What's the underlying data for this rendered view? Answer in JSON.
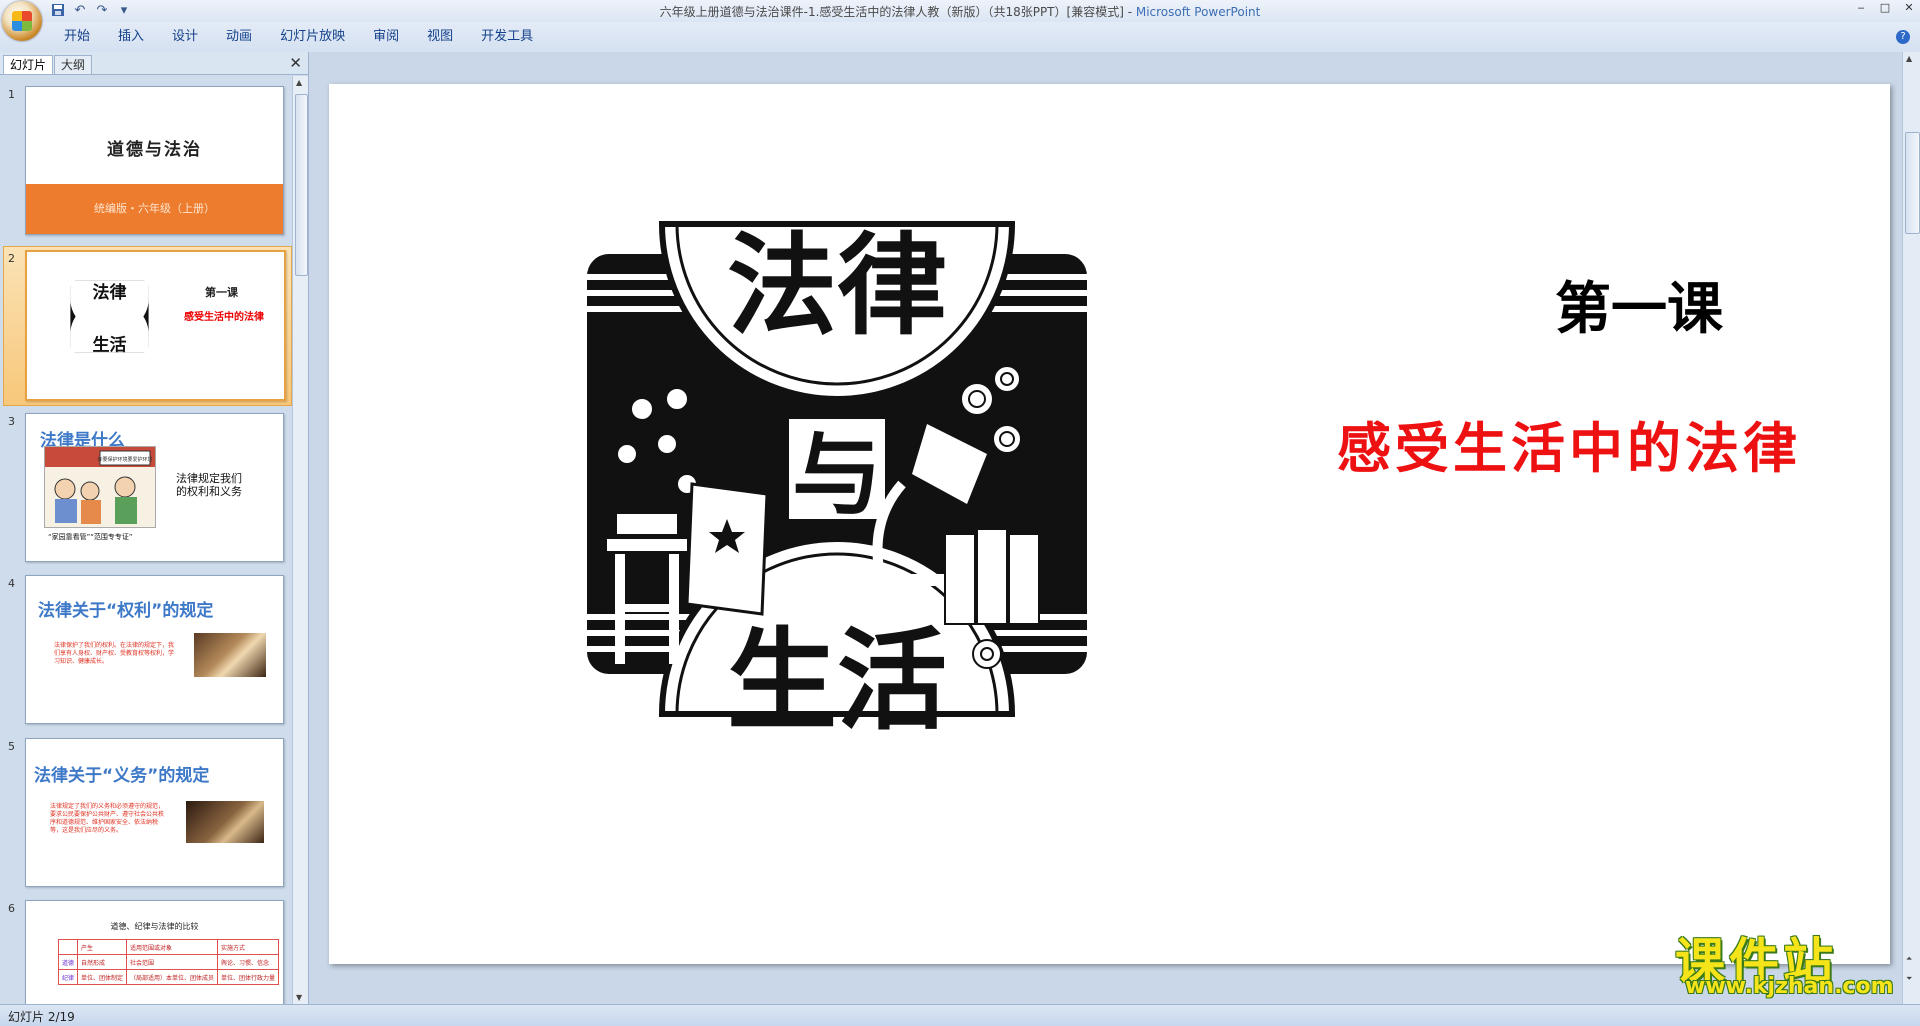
{
  "window": {
    "title": "六年级上册道德与法治课件-1.感受生活中的法律人教（新版）（共18张PPT）[兼容模式] - ",
    "app_name": "Microsoft PowerPoint",
    "controls": [
      "‒",
      "□",
      "✕"
    ]
  },
  "qat": {
    "save": "save-icon",
    "undo": "undo-icon",
    "redo": "redo-icon",
    "customize": "▾"
  },
  "ribbon": {
    "tabs": [
      "开始",
      "插入",
      "设计",
      "动画",
      "幻灯片放映",
      "审阅",
      "视图",
      "开发工具"
    ],
    "help": "?"
  },
  "panel": {
    "tab_slides": "幻灯片",
    "tab_outline": "大纲",
    "close": "✕"
  },
  "thumbnails": [
    {
      "num": "1",
      "title": "道德与法治",
      "band": "统编版・六年级（上册）"
    },
    {
      "num": "2",
      "title": "第一课",
      "subtitle": "感受生活中的法律",
      "emblem_top": "法律",
      "emblem_mid": "与",
      "emblem_bottom": "生活",
      "selected": true
    },
    {
      "num": "3",
      "heading": "法律是什么",
      "side_text_1": "法律规定我们",
      "side_text_2": "的权利和义务",
      "caption": "“家园靠看管”“范围专专证”",
      "pic_caption": "你要保护环境要爱护环境"
    },
    {
      "num": "4",
      "heading": "法律关于“权利”的规定",
      "body": "法律保护了我们的权利。在法律的规定下，我们享有人身权、财产权、受教育权等权利，学习知识、健康成长。"
    },
    {
      "num": "5",
      "heading": "法律关于“义务”的规定",
      "body": "法律规定了我们的义务和必须遵守的规范，要求公民要保护公共财产、遵守社会公共秩序和道德规范、维护国家安全、依法纳税等，这是我们应尽的义务。"
    },
    {
      "num": "6",
      "title": "道德、纪律与法律的比较",
      "table": [
        [
          "",
          "产生",
          "适用范围或对象",
          "实施方式"
        ],
        [
          "道德",
          "自然形成",
          "社会范围",
          "舆论、习惯、信念"
        ],
        [
          "纪律",
          "单位、团体制定",
          "（局部适用）本单位、团体成员",
          "单位、团体行政力量"
        ]
      ]
    }
  ],
  "slide": {
    "title": "第一课",
    "subtitle": "感受生活中的法律",
    "emblem": {
      "top": "法律",
      "middle": "与",
      "bottom": "生活"
    }
  },
  "watermark": {
    "main": "课件站",
    "url": "www.kjzhan.com"
  },
  "status": {
    "slide_indicator": "幻灯片 2/19"
  },
  "colors": {
    "orange_band": "#ee7c2e",
    "heading_blue": "#3e79c8",
    "subtitle_red": "#ee1111",
    "watermark_yellow": "#f5e41a"
  }
}
